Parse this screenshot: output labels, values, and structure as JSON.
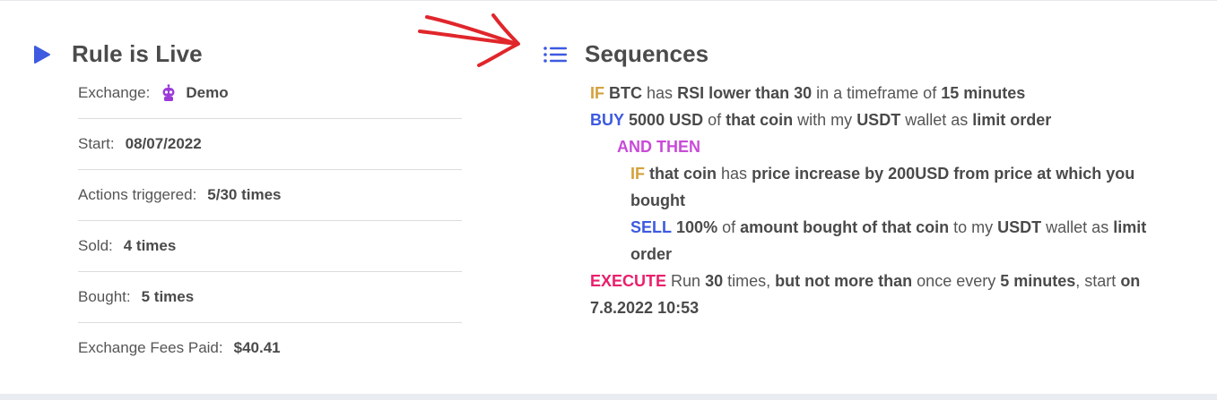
{
  "colors": {
    "accent_blue": "#3d5ae0",
    "if_gold": "#d4a13c",
    "and_purple": "#c94ad8",
    "execute_pink": "#ea1f6b",
    "annotation_red": "#e0262b"
  },
  "left": {
    "title": "Rule is Live",
    "icon": "play-icon",
    "stats": {
      "exchange_label": "Exchange:",
      "exchange_icon": "robot-icon",
      "exchange_value": "Demo",
      "start_label": "Start:",
      "start_value": "08/07/2022",
      "actions_label": "Actions triggered:",
      "actions_value": "5/30 times",
      "sold_label": "Sold:",
      "sold_value": "4 times",
      "bought_label": "Bought:",
      "bought_value": "5 times",
      "fees_label": "Exchange Fees Paid:",
      "fees_value": "$40.41"
    }
  },
  "right": {
    "title": "Sequences",
    "icon": "list-icon",
    "seq": {
      "l1_if": "IF",
      "l1_coin": "BTC",
      "l1_has": "has",
      "l1_cond": "RSI lower than 30",
      "l1_tf": "in a timeframe of",
      "l1_time": "15 minutes",
      "l2_buy": "BUY",
      "l2_amount": "5000 USD",
      "l2_of": "of",
      "l2_coin": "that coin",
      "l2_with": "with my",
      "l2_wallet": "USDT",
      "l2_as": "wallet as",
      "l2_order": "limit order",
      "l3_and": "AND THEN",
      "l4_if": "IF",
      "l4_coin": "that coin",
      "l4_has": "has",
      "l4_cond": "price increase by 200USD from price at which you bought",
      "l5_sell": "SELL",
      "l5_amount": "100%",
      "l5_of": "of",
      "l5_what": "amount bought of that coin",
      "l5_to": "to my",
      "l5_wallet": "USDT",
      "l5_as": "wallet as",
      "l5_order": "limit order",
      "l6_exec": "EXECUTE",
      "l6_run": "Run",
      "l6_times": "30",
      "l6_times_word": "times,",
      "l6_limit": "but not more than",
      "l6_once": "once every",
      "l6_interval": "5 minutes",
      "l6_start": ", start",
      "l6_on": "on",
      "l6_date": "7.8.2022 10:53"
    }
  }
}
